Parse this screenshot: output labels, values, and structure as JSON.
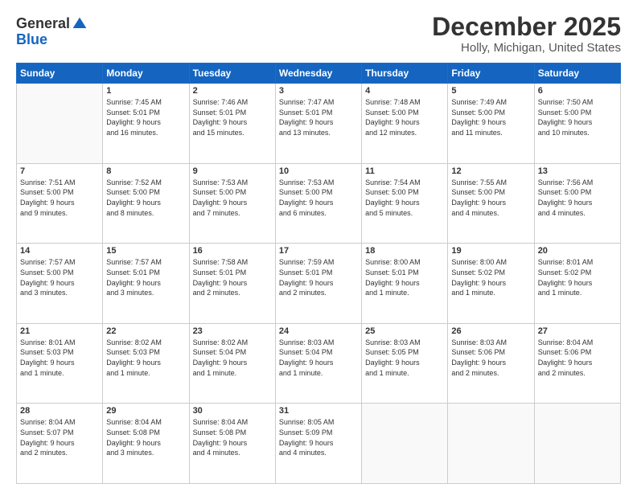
{
  "header": {
    "logo_line1": "General",
    "logo_line2": "Blue",
    "main_title": "December 2025",
    "subtitle": "Holly, Michigan, United States"
  },
  "calendar": {
    "days_of_week": [
      "Sunday",
      "Monday",
      "Tuesday",
      "Wednesday",
      "Thursday",
      "Friday",
      "Saturday"
    ],
    "weeks": [
      [
        {
          "day": "",
          "info": ""
        },
        {
          "day": "1",
          "info": "Sunrise: 7:45 AM\nSunset: 5:01 PM\nDaylight: 9 hours\nand 16 minutes."
        },
        {
          "day": "2",
          "info": "Sunrise: 7:46 AM\nSunset: 5:01 PM\nDaylight: 9 hours\nand 15 minutes."
        },
        {
          "day": "3",
          "info": "Sunrise: 7:47 AM\nSunset: 5:01 PM\nDaylight: 9 hours\nand 13 minutes."
        },
        {
          "day": "4",
          "info": "Sunrise: 7:48 AM\nSunset: 5:00 PM\nDaylight: 9 hours\nand 12 minutes."
        },
        {
          "day": "5",
          "info": "Sunrise: 7:49 AM\nSunset: 5:00 PM\nDaylight: 9 hours\nand 11 minutes."
        },
        {
          "day": "6",
          "info": "Sunrise: 7:50 AM\nSunset: 5:00 PM\nDaylight: 9 hours\nand 10 minutes."
        }
      ],
      [
        {
          "day": "7",
          "info": "Sunrise: 7:51 AM\nSunset: 5:00 PM\nDaylight: 9 hours\nand 9 minutes."
        },
        {
          "day": "8",
          "info": "Sunrise: 7:52 AM\nSunset: 5:00 PM\nDaylight: 9 hours\nand 8 minutes."
        },
        {
          "day": "9",
          "info": "Sunrise: 7:53 AM\nSunset: 5:00 PM\nDaylight: 9 hours\nand 7 minutes."
        },
        {
          "day": "10",
          "info": "Sunrise: 7:53 AM\nSunset: 5:00 PM\nDaylight: 9 hours\nand 6 minutes."
        },
        {
          "day": "11",
          "info": "Sunrise: 7:54 AM\nSunset: 5:00 PM\nDaylight: 9 hours\nand 5 minutes."
        },
        {
          "day": "12",
          "info": "Sunrise: 7:55 AM\nSunset: 5:00 PM\nDaylight: 9 hours\nand 4 minutes."
        },
        {
          "day": "13",
          "info": "Sunrise: 7:56 AM\nSunset: 5:00 PM\nDaylight: 9 hours\nand 4 minutes."
        }
      ],
      [
        {
          "day": "14",
          "info": "Sunrise: 7:57 AM\nSunset: 5:00 PM\nDaylight: 9 hours\nand 3 minutes."
        },
        {
          "day": "15",
          "info": "Sunrise: 7:57 AM\nSunset: 5:01 PM\nDaylight: 9 hours\nand 3 minutes."
        },
        {
          "day": "16",
          "info": "Sunrise: 7:58 AM\nSunset: 5:01 PM\nDaylight: 9 hours\nand 2 minutes."
        },
        {
          "day": "17",
          "info": "Sunrise: 7:59 AM\nSunset: 5:01 PM\nDaylight: 9 hours\nand 2 minutes."
        },
        {
          "day": "18",
          "info": "Sunrise: 8:00 AM\nSunset: 5:01 PM\nDaylight: 9 hours\nand 1 minute."
        },
        {
          "day": "19",
          "info": "Sunrise: 8:00 AM\nSunset: 5:02 PM\nDaylight: 9 hours\nand 1 minute."
        },
        {
          "day": "20",
          "info": "Sunrise: 8:01 AM\nSunset: 5:02 PM\nDaylight: 9 hours\nand 1 minute."
        }
      ],
      [
        {
          "day": "21",
          "info": "Sunrise: 8:01 AM\nSunset: 5:03 PM\nDaylight: 9 hours\nand 1 minute."
        },
        {
          "day": "22",
          "info": "Sunrise: 8:02 AM\nSunset: 5:03 PM\nDaylight: 9 hours\nand 1 minute."
        },
        {
          "day": "23",
          "info": "Sunrise: 8:02 AM\nSunset: 5:04 PM\nDaylight: 9 hours\nand 1 minute."
        },
        {
          "day": "24",
          "info": "Sunrise: 8:03 AM\nSunset: 5:04 PM\nDaylight: 9 hours\nand 1 minute."
        },
        {
          "day": "25",
          "info": "Sunrise: 8:03 AM\nSunset: 5:05 PM\nDaylight: 9 hours\nand 1 minute."
        },
        {
          "day": "26",
          "info": "Sunrise: 8:03 AM\nSunset: 5:06 PM\nDaylight: 9 hours\nand 2 minutes."
        },
        {
          "day": "27",
          "info": "Sunrise: 8:04 AM\nSunset: 5:06 PM\nDaylight: 9 hours\nand 2 minutes."
        }
      ],
      [
        {
          "day": "28",
          "info": "Sunrise: 8:04 AM\nSunset: 5:07 PM\nDaylight: 9 hours\nand 2 minutes."
        },
        {
          "day": "29",
          "info": "Sunrise: 8:04 AM\nSunset: 5:08 PM\nDaylight: 9 hours\nand 3 minutes."
        },
        {
          "day": "30",
          "info": "Sunrise: 8:04 AM\nSunset: 5:08 PM\nDaylight: 9 hours\nand 4 minutes."
        },
        {
          "day": "31",
          "info": "Sunrise: 8:05 AM\nSunset: 5:09 PM\nDaylight: 9 hours\nand 4 minutes."
        },
        {
          "day": "",
          "info": ""
        },
        {
          "day": "",
          "info": ""
        },
        {
          "day": "",
          "info": ""
        }
      ]
    ]
  }
}
